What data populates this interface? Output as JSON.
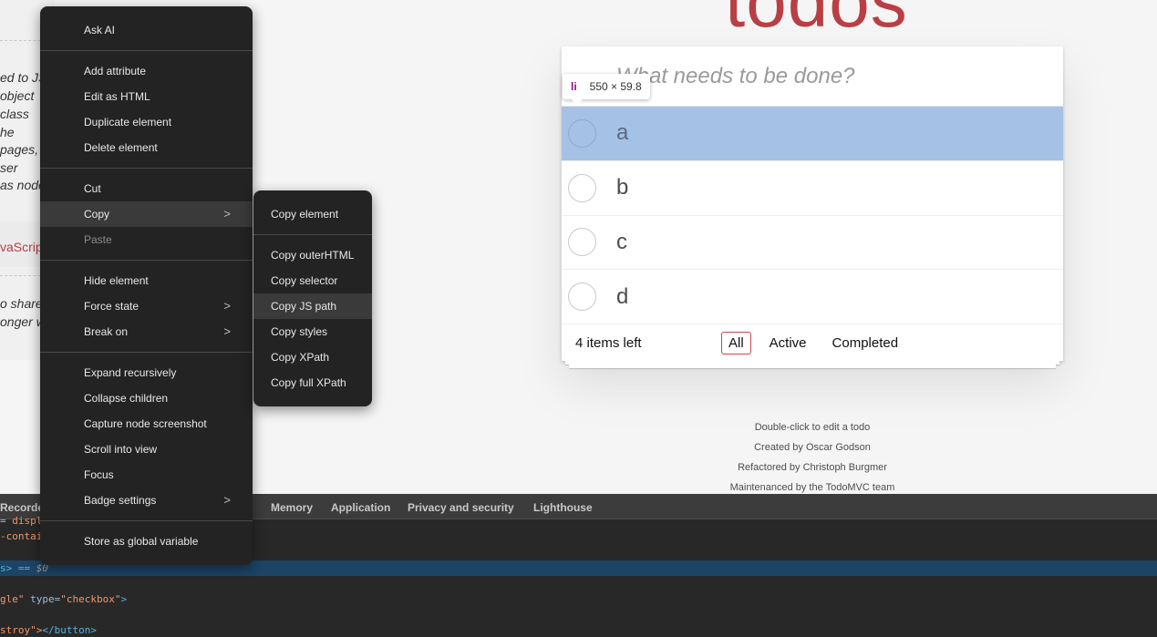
{
  "left_panel": {
    "lines": [
      "ed to JS",
      " object",
      "class",
      "he",
      "pages,",
      "ser",
      "as node"
    ],
    "red_text": "vaScrip",
    "lines2": [
      "o share,",
      "onger w"
    ]
  },
  "app": {
    "title": "todos",
    "new_todo_placeholder": "What needs to be done?",
    "items": [
      {
        "label": "a",
        "highlighted": true
      },
      {
        "label": "b"
      },
      {
        "label": "c"
      },
      {
        "label": "d"
      }
    ],
    "footer": {
      "count": "4 items left",
      "filters": [
        "All",
        "Active",
        "Completed"
      ],
      "selected_filter": "All"
    },
    "info": [
      "Double-click to edit a todo",
      "Created by Oscar Godson",
      "Refactored by Christoph Burgmer",
      "Maintenanced by the TodoMVC team"
    ]
  },
  "inspect_tooltip": {
    "tag": "li",
    "dims": "550 × 59.8"
  },
  "devtools": {
    "tabs": [
      "Recorder",
      "Memory",
      "Application",
      "Privacy and security",
      "Lighthouse"
    ],
    "code": {
      "line1_a": "= ",
      "line1_b": "displ",
      "line2": "-contai",
      "line3_a": "s> == ",
      "line3_b": "$0",
      "line4_a": "gle\"",
      "line4_attr": " type=",
      "line4_val": "\"checkbox\"",
      "line4_end": ">",
      "line5_a": "stroy\">",
      "line5_b": "</button>"
    }
  },
  "context_menu": {
    "items": {
      "ask_ai": "Ask AI",
      "add_attribute": "Add attribute",
      "edit_as_html": "Edit as HTML",
      "duplicate_element": "Duplicate element",
      "delete_element": "Delete element",
      "cut": "Cut",
      "copy": "Copy",
      "paste": "Paste",
      "hide_element": "Hide element",
      "force_state": "Force state",
      "break_on": "Break on",
      "expand_recursively": "Expand recursively",
      "collapse_children": "Collapse children",
      "capture_node_screenshot": "Capture node screenshot",
      "scroll_into_view": "Scroll into view",
      "focus": "Focus",
      "badge_settings": "Badge settings",
      "store_as_global_variable": "Store as global variable"
    },
    "submenu_arrow": ">"
  },
  "copy_submenu": {
    "items": {
      "copy_element": "Copy element",
      "copy_outerhtml": "Copy outerHTML",
      "copy_selector": "Copy selector",
      "copy_js_path": "Copy JS path",
      "copy_styles": "Copy styles",
      "copy_xpath": "Copy XPath",
      "copy_full_xpath": "Copy full XPath"
    },
    "active": "Copy JS path"
  }
}
